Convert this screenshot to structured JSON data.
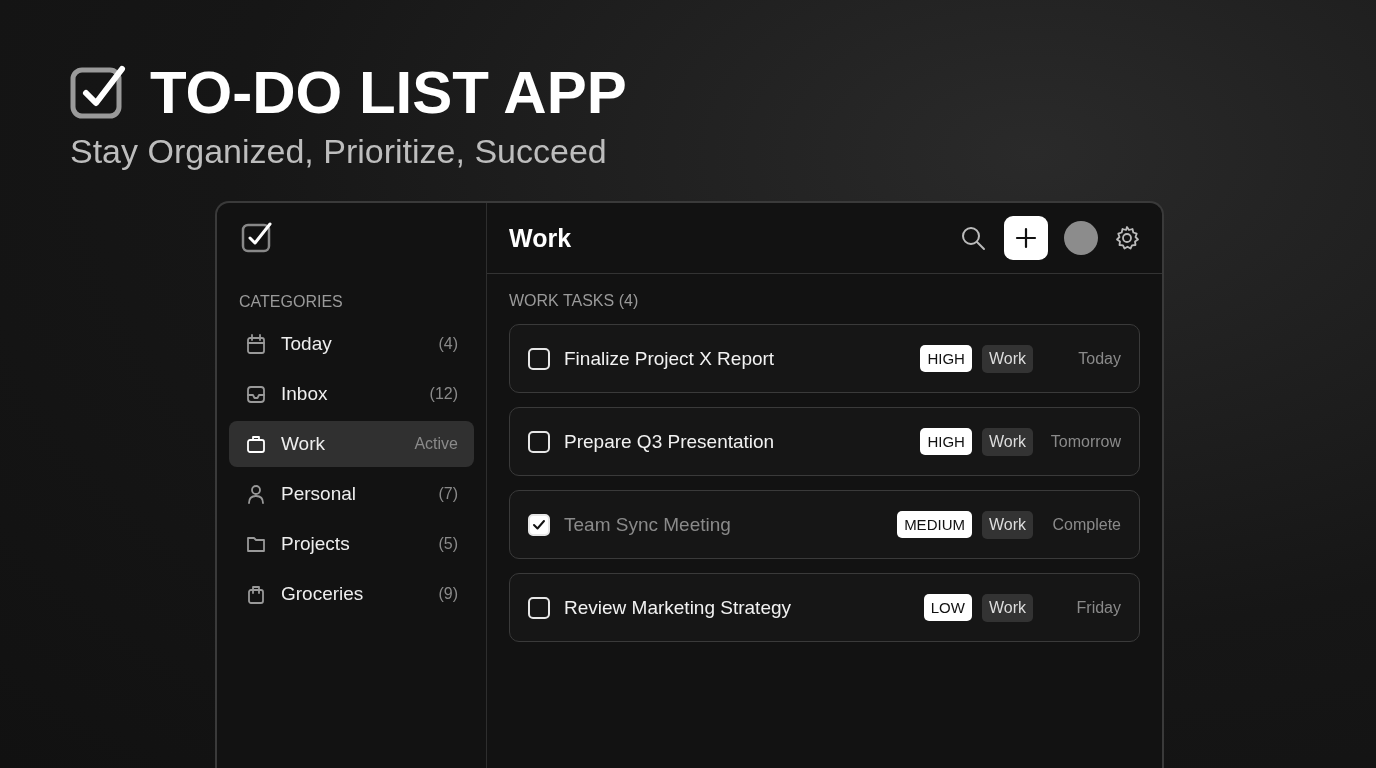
{
  "hero": {
    "title": "TO-DO LIST APP",
    "subtitle": "Stay Organized, Prioritize, Succeed"
  },
  "sidebar": {
    "heading": "CATEGORIES",
    "items": [
      {
        "label": "Today",
        "badge": "(4)",
        "selected": false
      },
      {
        "label": "Inbox",
        "badge": "(12)",
        "selected": false
      },
      {
        "label": "Work",
        "badge": "Active",
        "selected": true
      },
      {
        "label": "Personal",
        "badge": "(7)",
        "selected": false
      },
      {
        "label": "Projects",
        "badge": "(5)",
        "selected": false
      },
      {
        "label": "Groceries",
        "badge": "(9)",
        "selected": false
      }
    ]
  },
  "main": {
    "title": "Work",
    "section_heading": "WORK TASKS (4)",
    "tasks": [
      {
        "title": "Finalize Project X Report",
        "checked": false,
        "priority": "HIGH",
        "category": "Work",
        "due": "Today"
      },
      {
        "title": "Prepare Q3 Presentation",
        "checked": false,
        "priority": "HIGH",
        "category": "Work",
        "due": "Tomorrow"
      },
      {
        "title": "Team Sync Meeting",
        "checked": true,
        "priority": "MEDIUM",
        "category": "Work",
        "due": "Complete"
      },
      {
        "title": "Review Marketing Strategy",
        "checked": false,
        "priority": "LOW",
        "category": "Work",
        "due": "Friday"
      }
    ]
  }
}
